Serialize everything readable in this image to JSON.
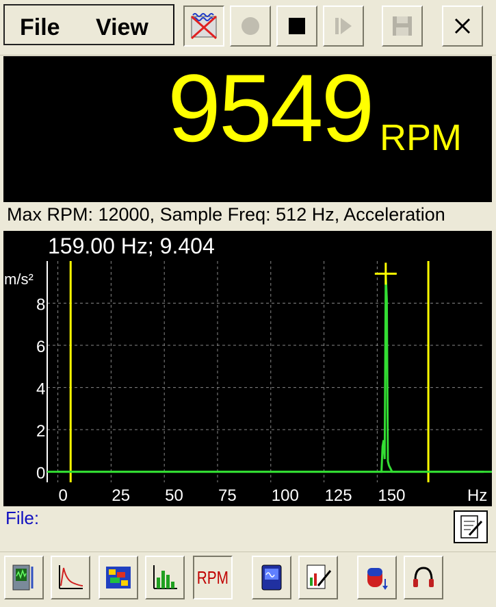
{
  "menu": {
    "file_label": "File",
    "view_label": "View"
  },
  "display": {
    "rpm_value": "9549",
    "rpm_unit": "RPM"
  },
  "info_line": "Max RPM: 12000, Sample Freq: 512 Hz, Acceleration",
  "cursor_readout": "159.00 Hz; 9.404",
  "file_bar": {
    "label": "File:"
  },
  "bottom_tabs": {
    "rpm_label": "RPM"
  },
  "colors": {
    "digits": "#ffff00",
    "spectrum": "#33dd33",
    "marker": "#ffff00",
    "grid": "#888888"
  },
  "chart_data": {
    "type": "line",
    "ylabel": "m/s²",
    "xlabel": "Hz",
    "xlim": [
      -5,
      200
    ],
    "ylim": [
      -0.5,
      10
    ],
    "x_ticks": [
      0,
      25,
      50,
      75,
      100,
      125,
      150
    ],
    "y_ticks": [
      0,
      2,
      4,
      6,
      8
    ],
    "grid": true,
    "series": [
      {
        "x": [
          0,
          140,
          152,
          152.5,
          153,
          153.5,
          154,
          154.5,
          155,
          155.5,
          156,
          156.5,
          157,
          200
        ],
        "y": [
          0,
          0,
          0,
          1.2,
          1.5,
          0.6,
          9.4,
          8.2,
          0.5,
          0.3,
          0.2,
          0.1,
          0,
          0
        ]
      }
    ],
    "markers_x": [
      6,
      174
    ],
    "cursor": {
      "x": 154,
      "y": 9.4
    }
  }
}
